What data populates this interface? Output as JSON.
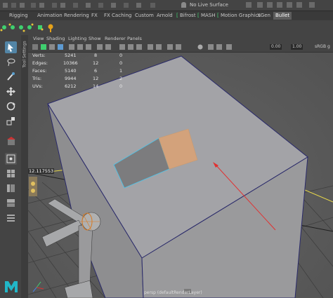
{
  "topline": {
    "live_surface": "No Live Surface"
  },
  "shelf_tabs": [
    {
      "label": "Rigging",
      "active": false
    },
    {
      "label": "Animation",
      "active": false
    },
    {
      "label": "Rendering",
      "active": false
    },
    {
      "label": "FX",
      "active": false
    },
    {
      "label": "FX Caching",
      "active": false
    },
    {
      "label": "Custom",
      "active": false
    },
    {
      "label": "Arnold",
      "active": false
    },
    {
      "label": "Bifrost",
      "active": false
    },
    {
      "label": "MASH",
      "active": false
    },
    {
      "label": "Motion Graphics",
      "active": false
    },
    {
      "label": "XGen",
      "active": false
    },
    {
      "label": "Bullet",
      "active": true
    }
  ],
  "toolbox": {
    "side_tab": "Tool Settings"
  },
  "panel_menu": [
    "View",
    "Shading",
    "Lighting",
    "Show",
    "Renderer",
    "Panels"
  ],
  "panel_tools": {
    "exposure": "0.00",
    "gamma": "1.00",
    "color_space": "sRGB g"
  },
  "hud": [
    {
      "label": "Verts:",
      "a": "5241",
      "b": "8",
      "c": "0"
    },
    {
      "label": "Edges:",
      "a": "10366",
      "b": "12",
      "c": "0"
    },
    {
      "label": "Faces:",
      "a": "5140",
      "b": "6",
      "c": "1"
    },
    {
      "label": "Tris:",
      "a": "9944",
      "b": "12",
      "c": "2"
    },
    {
      "label": "UVs:",
      "a": "6212",
      "b": "14",
      "c": "0"
    }
  ],
  "manip_value": "12.117553",
  "camera_label": "persp (defaultRenderLayer)",
  "colors": {
    "viewport_bg": "#5b5b5b",
    "cube_top": "#a3a3a7",
    "cube_front": "#9a9a9c",
    "selected_face": "#d3a27b",
    "accent_green": "#3fd06f",
    "manip_red": "#e23030",
    "maya_logo": "#21b6c7"
  }
}
